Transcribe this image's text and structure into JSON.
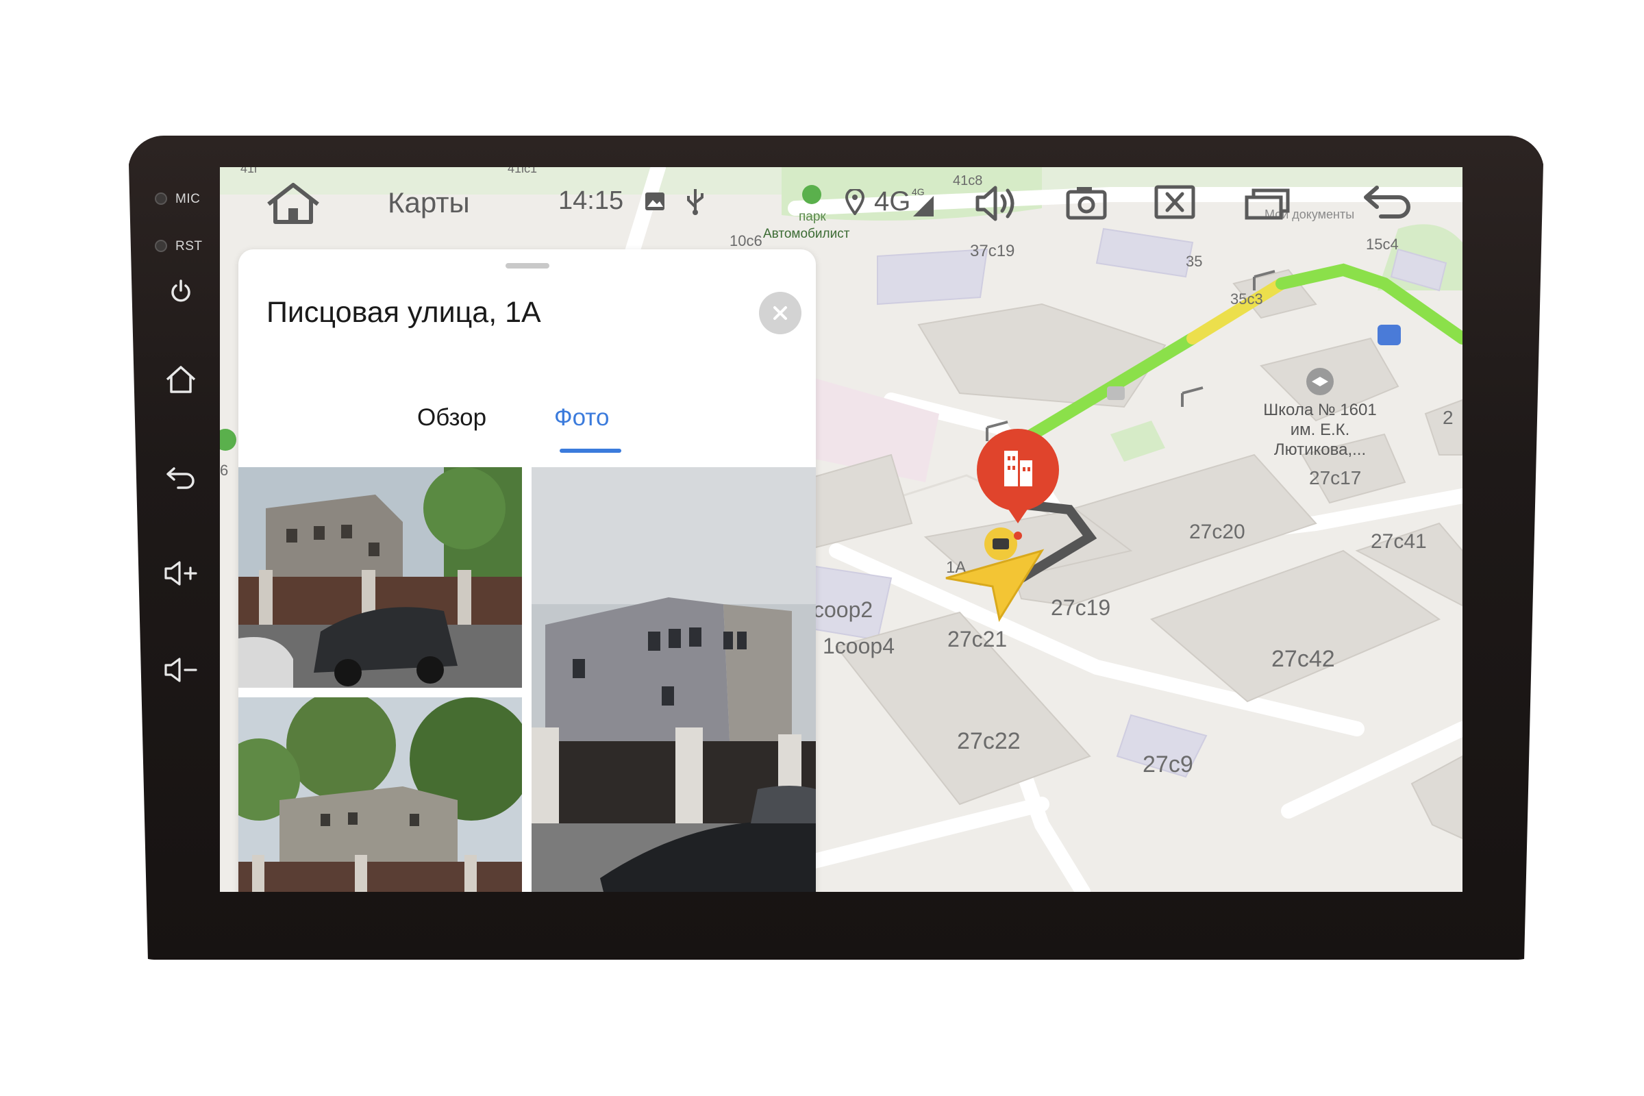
{
  "device": {
    "mic_label": "MIC",
    "rst_label": "RST"
  },
  "status_bar": {
    "app_title": "Карты",
    "time": "14:15",
    "network": "4G",
    "network_sup": "4G"
  },
  "map_labels": {
    "park_line1": "парк",
    "park_line2": "Автомобилист",
    "my_documents": "Мои документы",
    "school_line1": "Школа № 1601",
    "school_line2": "им. Е.К.",
    "school_line3": "Лютикова,...",
    "b_41l": "41l",
    "b_41lc1": "41lc1",
    "b_41c8": "41c8",
    "b_10c6": "10c6",
    "b_37c19": "37c19",
    "b_35": "35",
    "b_35c3": "35c3",
    "b_15c4": "15c4",
    "b_27c17": "27c17",
    "b_27c20": "27c20",
    "b_27c41": "27c41",
    "b_27c19": "27c19",
    "b_27c21": "27c21",
    "b_27c42": "27c42",
    "b_27c22": "27c22",
    "b_27c9": "27c9",
    "b_coop2": "coop2",
    "b_1coop4": "1coop4",
    "b_1a": "1A",
    "b_2": "2",
    "b_6": "6"
  },
  "panel": {
    "address": "Писцовая улица, 1А",
    "tabs": [
      {
        "label": "Обзор",
        "active": false
      },
      {
        "label": "Фото",
        "active": true
      }
    ]
  },
  "colors": {
    "route_green": "#8be04a",
    "route_yellow": "#ecdf4c",
    "accent_blue": "#3b7bdc",
    "pin_red": "#e0442c",
    "arrow_yellow": "#f3c534"
  }
}
